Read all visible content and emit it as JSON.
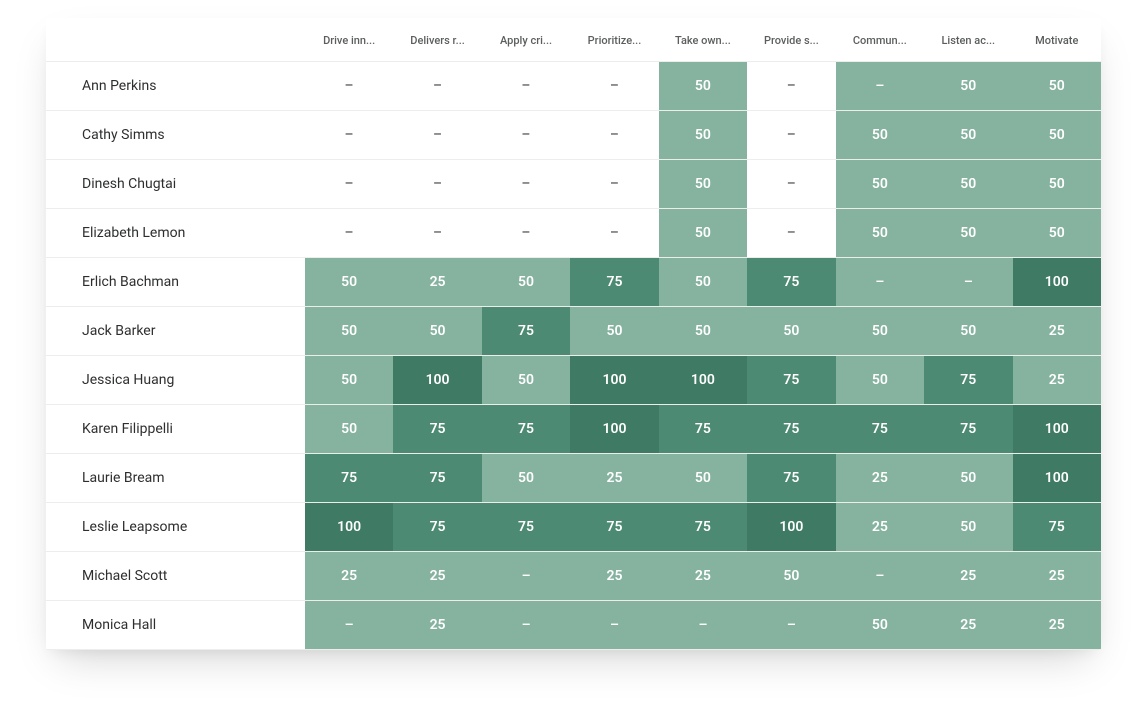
{
  "columns": [
    {
      "label": "Drive inn..."
    },
    {
      "label": "Delivers r..."
    },
    {
      "label": "Apply cri..."
    },
    {
      "label": "Prioritize..."
    },
    {
      "label": "Take own..."
    },
    {
      "label": "Provide s..."
    },
    {
      "label": "Commun..."
    },
    {
      "label": "Listen ac..."
    },
    {
      "label": "Motivate"
    }
  ],
  "rows": [
    {
      "name": "Ann Perkins",
      "values": [
        null,
        null,
        null,
        null,
        50,
        null,
        "dash",
        50,
        50
      ]
    },
    {
      "name": "Cathy Simms",
      "values": [
        null,
        null,
        null,
        null,
        50,
        null,
        50,
        50,
        50
      ]
    },
    {
      "name": "Dinesh Chugtai",
      "values": [
        null,
        null,
        null,
        null,
        50,
        null,
        50,
        50,
        50
      ]
    },
    {
      "name": "Elizabeth Lemon",
      "values": [
        null,
        null,
        null,
        null,
        50,
        null,
        50,
        50,
        50
      ]
    },
    {
      "name": "Erlich Bachman",
      "values": [
        50,
        25,
        50,
        75,
        50,
        75,
        "dash",
        "dash",
        100
      ]
    },
    {
      "name": "Jack Barker",
      "values": [
        50,
        50,
        75,
        50,
        50,
        50,
        50,
        50,
        25
      ]
    },
    {
      "name": "Jessica Huang",
      "values": [
        50,
        100,
        50,
        100,
        100,
        75,
        50,
        75,
        25
      ]
    },
    {
      "name": "Karen Filippelli",
      "values": [
        50,
        75,
        75,
        100,
        75,
        75,
        75,
        75,
        100
      ]
    },
    {
      "name": "Laurie Bream",
      "values": [
        75,
        75,
        50,
        25,
        50,
        75,
        25,
        50,
        100
      ]
    },
    {
      "name": "Leslie Leapsome",
      "values": [
        100,
        75,
        75,
        75,
        75,
        100,
        25,
        50,
        75
      ]
    },
    {
      "name": "Michael Scott",
      "values": [
        25,
        25,
        "dash",
        25,
        25,
        50,
        "dash",
        25,
        25
      ]
    },
    {
      "name": "Monica Hall",
      "values": [
        "dash",
        25,
        "dash",
        "dash",
        "dash",
        "dash",
        50,
        25,
        25
      ]
    }
  ],
  "palette": {
    "light": "#86b39f",
    "mid": "#6ea48e",
    "dark": "#4d8a73",
    "darker": "#3f7a64"
  },
  "em_dash": "–"
}
